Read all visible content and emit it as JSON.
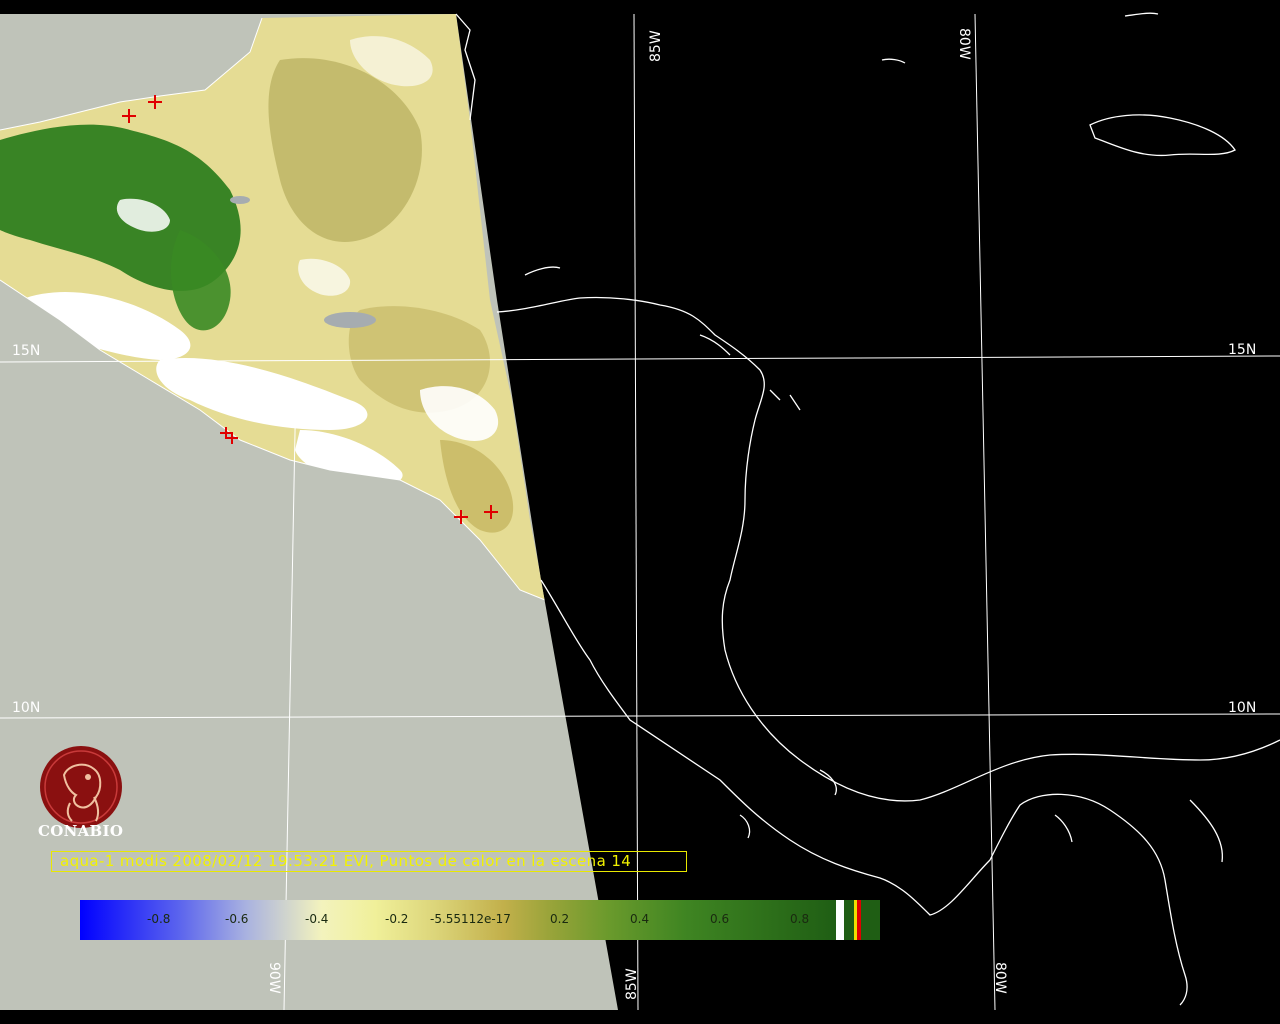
{
  "caption": "aqua-1 modis 2008/02/12 19:53:21 EVI, Puntos de calor en la escena 14",
  "logo": {
    "name": "CONABIO",
    "icon": "conabio-parrot-logo"
  },
  "grid_labels": {
    "lat_15_left": "15N",
    "lat_15_right": "15N",
    "lat_10_left": "10N",
    "lat_10_right": "10N",
    "lon_85_top": "85W",
    "lon_80_top": "80W",
    "lon_90_bottom": "90W",
    "lon_85_bottom": "85W",
    "lon_80_bottom": "80W"
  },
  "colorbar": {
    "ticks": [
      "-0.8",
      "-0.6",
      "-0.4",
      "-0.2",
      "-5.55112e-17",
      "0.2",
      "0.4",
      "0.6",
      "0.8"
    ],
    "colors": {
      "low": "#0000ff",
      "mid": "#f3f3bd",
      "high": "#1f5e14",
      "no_data": "#ffffff",
      "fire": "#e00000"
    }
  },
  "colors": {
    "background": "#000000",
    "swath_fill": "#bfc3b9",
    "coastline": "#ffffff",
    "fire_marker": "#e00000",
    "caption_text": "#f2f200"
  },
  "fire_points_visible": 6
}
